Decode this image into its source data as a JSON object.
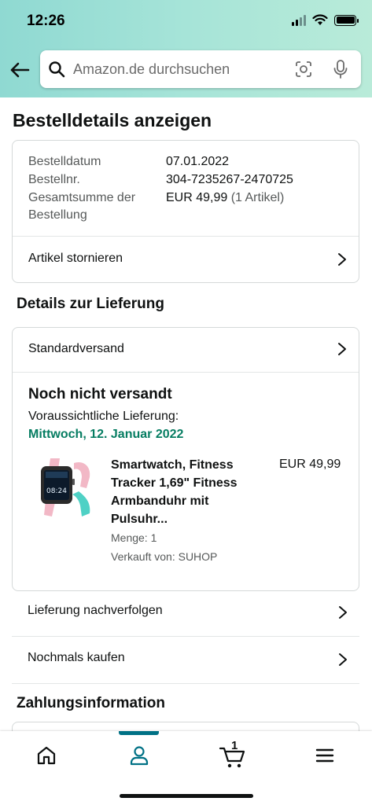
{
  "status_bar": {
    "time": "12:26"
  },
  "search": {
    "placeholder": "Amazon.de durchsuchen"
  },
  "page": {
    "title": "Bestelldetails anzeigen"
  },
  "order_summary": {
    "rows": [
      {
        "label": "Bestelldatum",
        "value": "07.01.2022"
      },
      {
        "label": "Bestellnr.",
        "value": "304-7235267-2470725"
      },
      {
        "label": "Gesamtsumme der Bestellung",
        "value": "EUR 49,99",
        "value_note": "(1 Artikel)"
      }
    ],
    "cancel_label": "Artikel stornieren"
  },
  "delivery": {
    "section_title": "Details zur Lieferung",
    "shipping_method": "Standardversand",
    "status": "Noch nicht versandt",
    "expected_label": "Voraussichtliche Lieferung:",
    "expected_date": "Mittwoch, 12. Januar 2022",
    "product": {
      "title": "Smartwatch, Fitness Tracker 1,69\" Fitness Armbanduhr mit Pulsuhr...",
      "price": "EUR 49,99",
      "quantity": "Menge: 1",
      "seller": "Verkauft von: SUHOP",
      "watch_time": "08:24"
    }
  },
  "actions": {
    "track_label": "Lieferung nachverfolgen",
    "buy_again_label": "Nochmals kaufen"
  },
  "payment": {
    "section_title": "Zahlungsinformation"
  },
  "bottom_nav": {
    "cart_count": "1",
    "items": [
      "home-icon",
      "user-icon",
      "cart-icon",
      "menu-icon"
    ],
    "active_item": "user-icon",
    "accent_color": "#007185"
  },
  "colors": {
    "delivery_green": "#067d62",
    "header_gradient": [
      "#8fd9d2",
      "#b9ebd9"
    ]
  }
}
